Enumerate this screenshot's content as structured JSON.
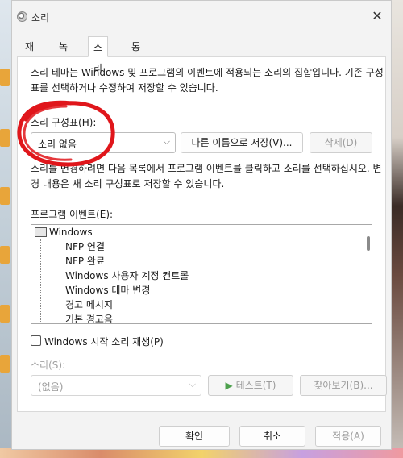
{
  "window": {
    "title": "소리"
  },
  "tabs": [
    {
      "label": "재생"
    },
    {
      "label": "녹음"
    },
    {
      "label": "소리"
    },
    {
      "label": "통신"
    }
  ],
  "panel": {
    "description": "소리 테마는 Windows 및 프로그램의 이벤트에 적용되는 소리의 집합입니다. 기존 구성표를 선택하거나 수정하여 저장할 수 있습니다.",
    "scheme_label": "소리 구성표(H):",
    "scheme_value": "소리 없음",
    "save_as_label": "다른 이름으로 저장(V)...",
    "delete_label": "삭제(D)",
    "change_description": "소리를 변경하려면 다음 목록에서 프로그램 이벤트를 클릭하고 소리를 선택하십시오. 변경 내용은 새 소리 구성표로 저장할 수 있습니다.",
    "events_label": "프로그램 이벤트(E):",
    "events": [
      "Windows",
      "NFP 연결",
      "NFP 완료",
      "Windows 사용자 계정 컨트롤",
      "Windows 테마 변경",
      "경고 메시지",
      "기본 경고음"
    ],
    "startup_checkbox_label": "Windows 시작 소리 재생(P)",
    "startup_checked": false,
    "sounds_label": "소리(S):",
    "sounds_value": "(없음)",
    "test_label": "테스트(T)",
    "browse_label": "찾아보기(B)..."
  },
  "footer": {
    "ok_label": "확인",
    "cancel_label": "취소",
    "apply_label": "적용(A)"
  },
  "colors": {
    "annotation": "#e0161b",
    "window_bg": "#f3f3f3",
    "panel_bg": "#ffffff"
  }
}
